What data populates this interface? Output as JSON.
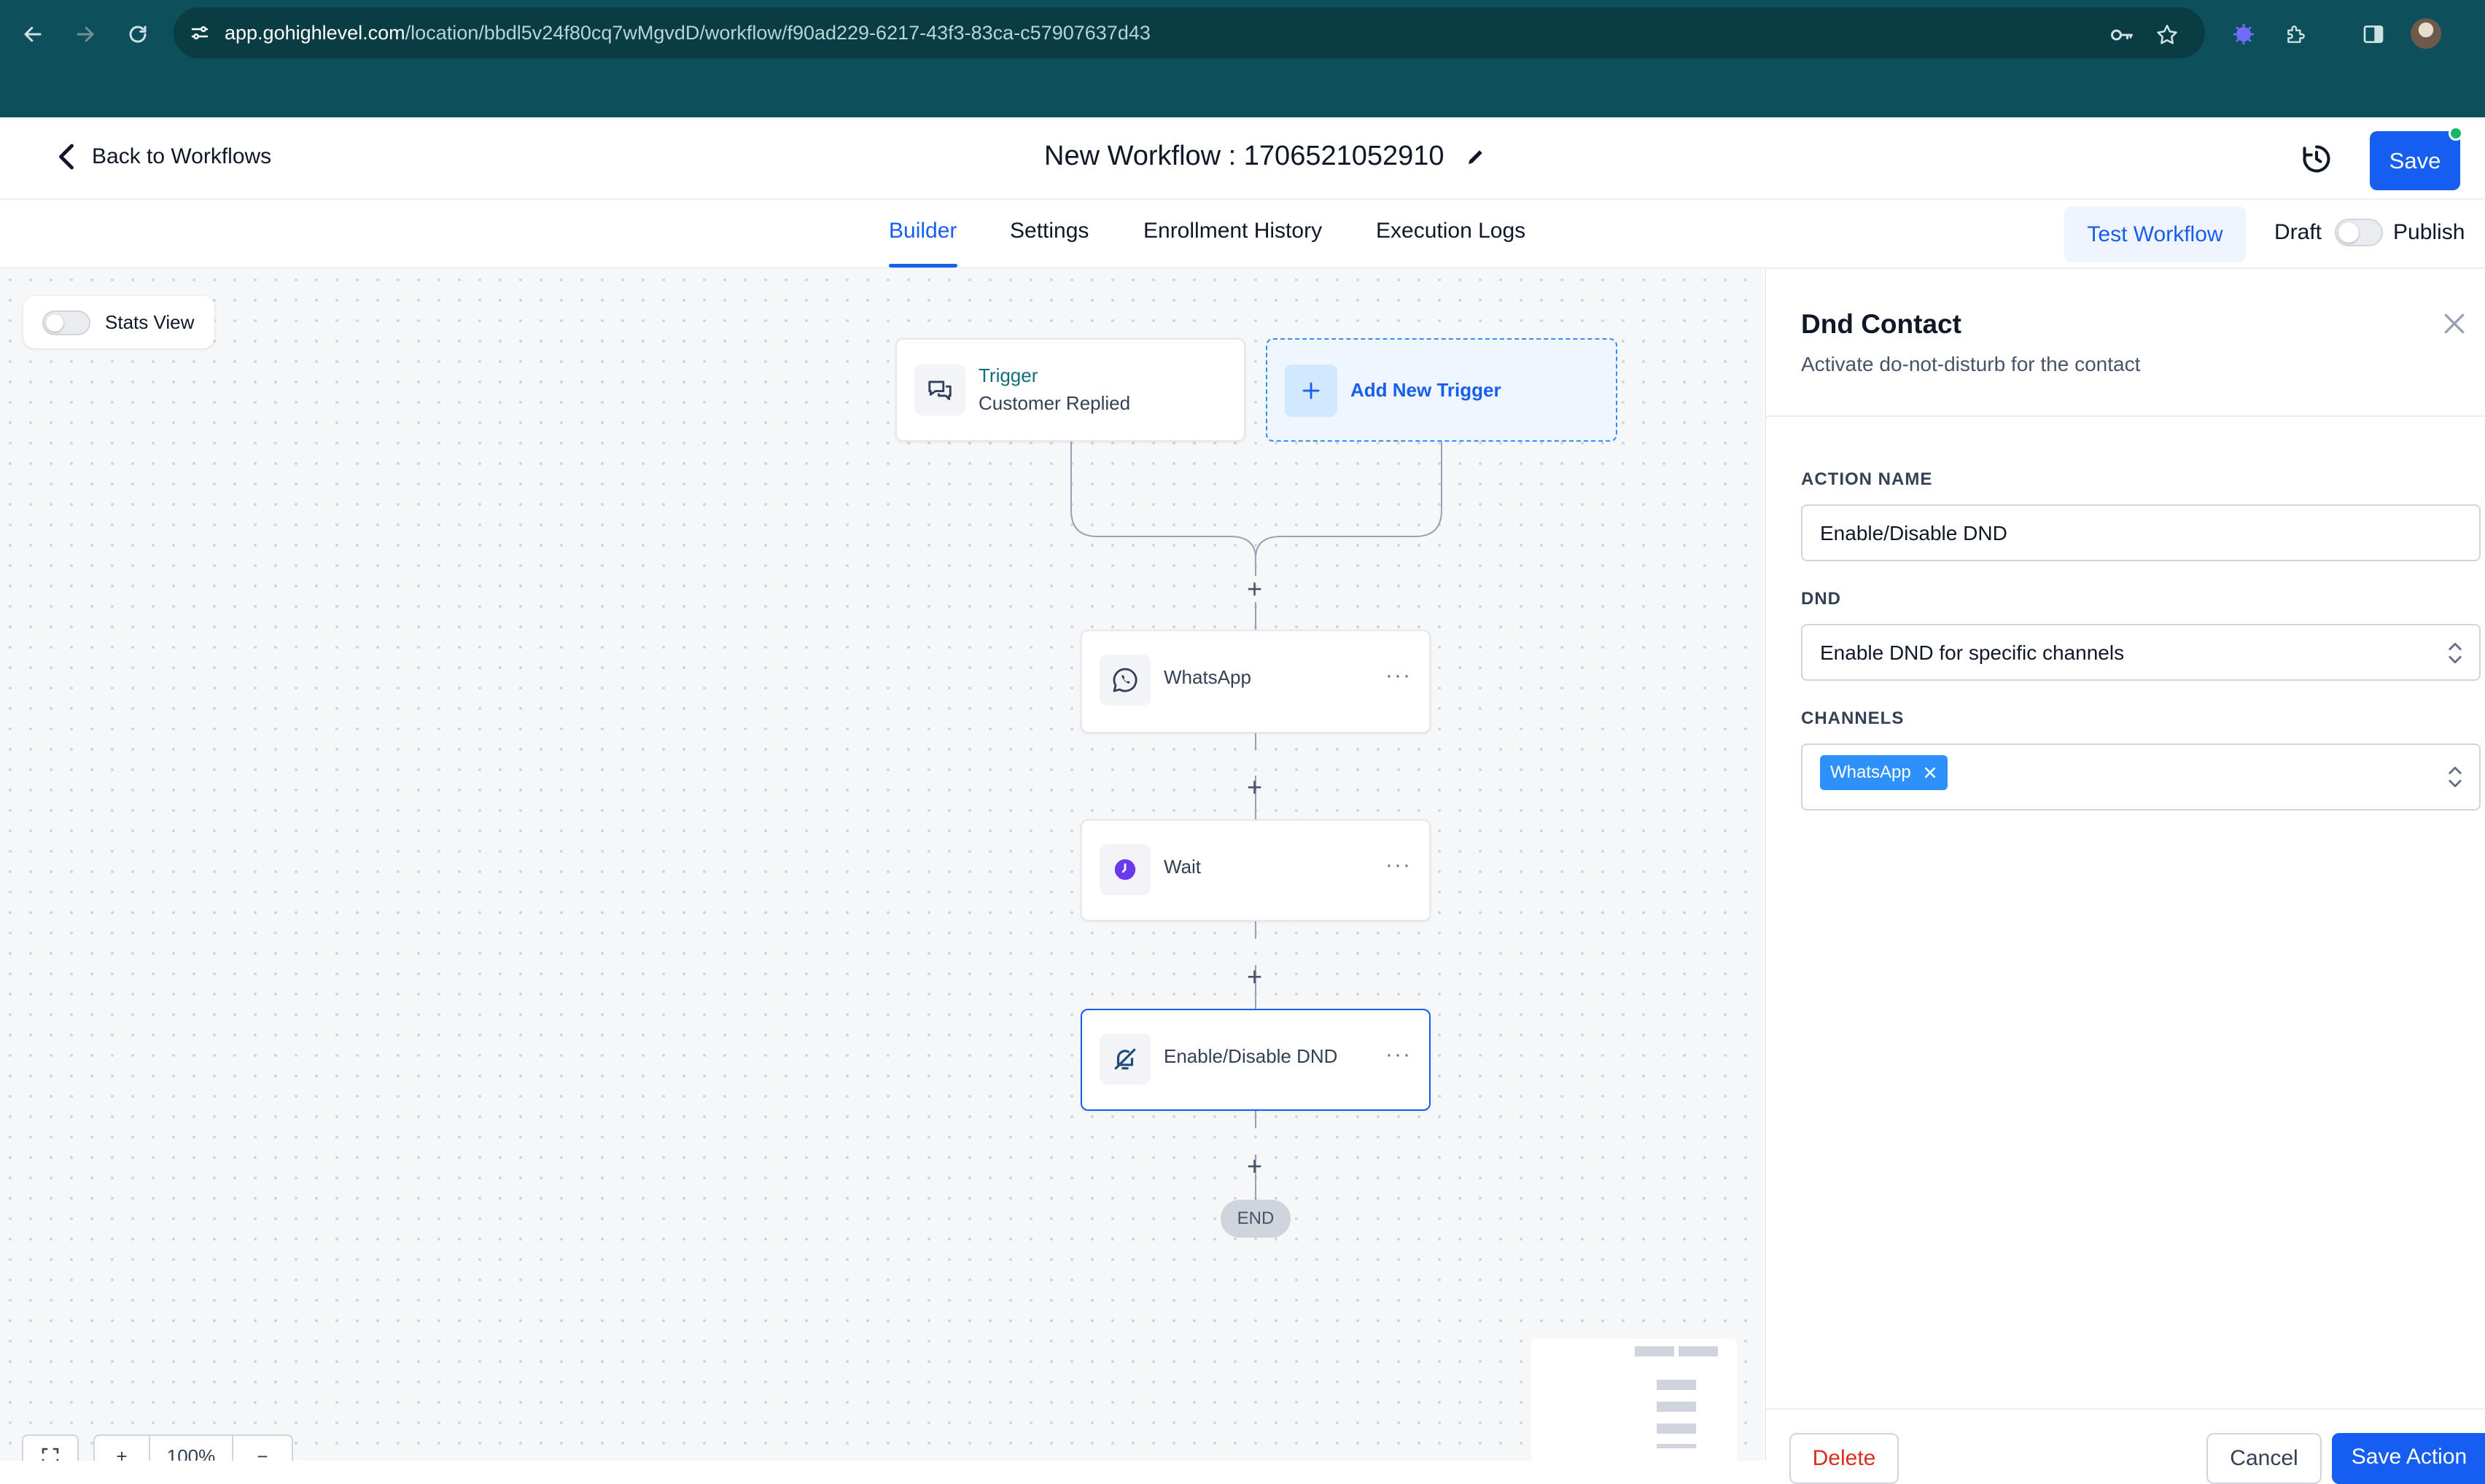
{
  "browser": {
    "url_host": "app.gohighlevel.com",
    "url_path": "/location/bbdl5v24f80cq7wMgvdD/workflow/f90ad229-6217-43f3-83ca-c57907637d43",
    "icons": [
      "back-arrow-icon",
      "forward-arrow-icon",
      "reload-icon",
      "tune-icon",
      "key-icon",
      "star-icon",
      "extension-icon",
      "puzzle-icon",
      "sidepanel-icon",
      "avatar"
    ]
  },
  "header": {
    "back_label": "Back to Workflows",
    "title": "New Workflow : 1706521052910",
    "save_label": "Save"
  },
  "tabs": [
    {
      "label": "Builder",
      "active": true
    },
    {
      "label": "Settings",
      "active": false
    },
    {
      "label": "Enrollment History",
      "active": false
    },
    {
      "label": "Execution Logs",
      "active": false
    }
  ],
  "toolbar": {
    "test_label": "Test Workflow",
    "draft_label": "Draft",
    "publish_label": "Publish",
    "publish_on": false
  },
  "canvas": {
    "stats_label": "Stats View",
    "stats_on": false,
    "trigger": {
      "title": "Trigger",
      "subtitle": "Customer Replied"
    },
    "add_trigger_label": "Add New Trigger",
    "actions": [
      {
        "label": "WhatsApp",
        "icon": "whatsapp-icon"
      },
      {
        "label": "Wait",
        "icon": "clock-icon"
      },
      {
        "label": "Enable/Disable DND",
        "icon": "bell-off-icon",
        "selected": true
      }
    ],
    "end_label": "END",
    "zoom_label": "100%"
  },
  "panel": {
    "title": "Dnd Contact",
    "subtitle": "Activate do-not-disturb for the contact",
    "action_name_label": "ACTION NAME",
    "action_name_value": "Enable/Disable DND",
    "dnd_label": "DND",
    "dnd_value": "Enable DND for specific channels",
    "channels_label": "CHANNELS",
    "channel_chip": "WhatsApp",
    "delete_label": "Delete",
    "cancel_label": "Cancel",
    "save_action_label": "Save Action"
  },
  "colors": {
    "brand_bar": "#0d4f5a",
    "primary": "#155eef",
    "chip": "#2e90fa",
    "danger": "#d92d20",
    "canvas_bg": "#f6f7f9"
  }
}
